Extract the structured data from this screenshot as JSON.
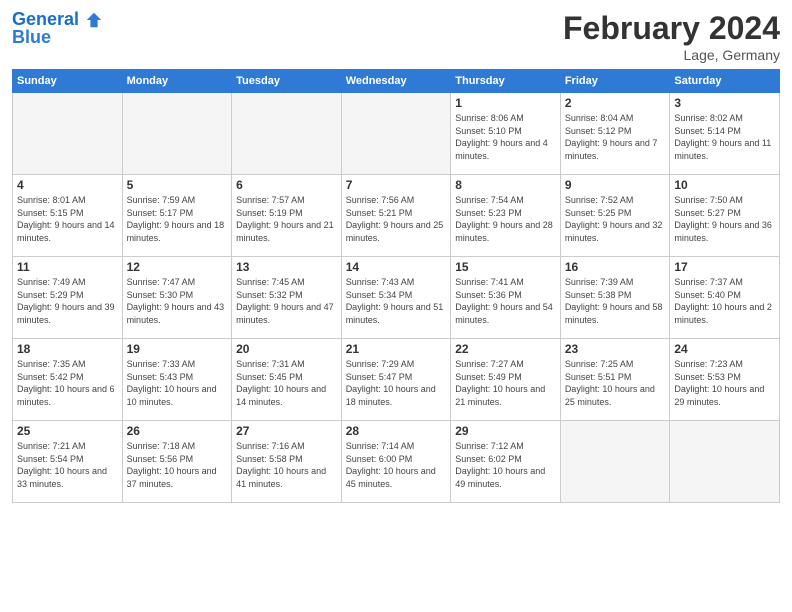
{
  "header": {
    "logo_line1": "General",
    "logo_line2": "Blue",
    "month_year": "February 2024",
    "location": "Lage, Germany"
  },
  "weekdays": [
    "Sunday",
    "Monday",
    "Tuesday",
    "Wednesday",
    "Thursday",
    "Friday",
    "Saturday"
  ],
  "weeks": [
    [
      {
        "day": "",
        "info": ""
      },
      {
        "day": "",
        "info": ""
      },
      {
        "day": "",
        "info": ""
      },
      {
        "day": "",
        "info": ""
      },
      {
        "day": "1",
        "info": "Sunrise: 8:06 AM\nSunset: 5:10 PM\nDaylight: 9 hours\nand 4 minutes."
      },
      {
        "day": "2",
        "info": "Sunrise: 8:04 AM\nSunset: 5:12 PM\nDaylight: 9 hours\nand 7 minutes."
      },
      {
        "day": "3",
        "info": "Sunrise: 8:02 AM\nSunset: 5:14 PM\nDaylight: 9 hours\nand 11 minutes."
      }
    ],
    [
      {
        "day": "4",
        "info": "Sunrise: 8:01 AM\nSunset: 5:15 PM\nDaylight: 9 hours\nand 14 minutes."
      },
      {
        "day": "5",
        "info": "Sunrise: 7:59 AM\nSunset: 5:17 PM\nDaylight: 9 hours\nand 18 minutes."
      },
      {
        "day": "6",
        "info": "Sunrise: 7:57 AM\nSunset: 5:19 PM\nDaylight: 9 hours\nand 21 minutes."
      },
      {
        "day": "7",
        "info": "Sunrise: 7:56 AM\nSunset: 5:21 PM\nDaylight: 9 hours\nand 25 minutes."
      },
      {
        "day": "8",
        "info": "Sunrise: 7:54 AM\nSunset: 5:23 PM\nDaylight: 9 hours\nand 28 minutes."
      },
      {
        "day": "9",
        "info": "Sunrise: 7:52 AM\nSunset: 5:25 PM\nDaylight: 9 hours\nand 32 minutes."
      },
      {
        "day": "10",
        "info": "Sunrise: 7:50 AM\nSunset: 5:27 PM\nDaylight: 9 hours\nand 36 minutes."
      }
    ],
    [
      {
        "day": "11",
        "info": "Sunrise: 7:49 AM\nSunset: 5:29 PM\nDaylight: 9 hours\nand 39 minutes."
      },
      {
        "day": "12",
        "info": "Sunrise: 7:47 AM\nSunset: 5:30 PM\nDaylight: 9 hours\nand 43 minutes."
      },
      {
        "day": "13",
        "info": "Sunrise: 7:45 AM\nSunset: 5:32 PM\nDaylight: 9 hours\nand 47 minutes."
      },
      {
        "day": "14",
        "info": "Sunrise: 7:43 AM\nSunset: 5:34 PM\nDaylight: 9 hours\nand 51 minutes."
      },
      {
        "day": "15",
        "info": "Sunrise: 7:41 AM\nSunset: 5:36 PM\nDaylight: 9 hours\nand 54 minutes."
      },
      {
        "day": "16",
        "info": "Sunrise: 7:39 AM\nSunset: 5:38 PM\nDaylight: 9 hours\nand 58 minutes."
      },
      {
        "day": "17",
        "info": "Sunrise: 7:37 AM\nSunset: 5:40 PM\nDaylight: 10 hours\nand 2 minutes."
      }
    ],
    [
      {
        "day": "18",
        "info": "Sunrise: 7:35 AM\nSunset: 5:42 PM\nDaylight: 10 hours\nand 6 minutes."
      },
      {
        "day": "19",
        "info": "Sunrise: 7:33 AM\nSunset: 5:43 PM\nDaylight: 10 hours\nand 10 minutes."
      },
      {
        "day": "20",
        "info": "Sunrise: 7:31 AM\nSunset: 5:45 PM\nDaylight: 10 hours\nand 14 minutes."
      },
      {
        "day": "21",
        "info": "Sunrise: 7:29 AM\nSunset: 5:47 PM\nDaylight: 10 hours\nand 18 minutes."
      },
      {
        "day": "22",
        "info": "Sunrise: 7:27 AM\nSunset: 5:49 PM\nDaylight: 10 hours\nand 21 minutes."
      },
      {
        "day": "23",
        "info": "Sunrise: 7:25 AM\nSunset: 5:51 PM\nDaylight: 10 hours\nand 25 minutes."
      },
      {
        "day": "24",
        "info": "Sunrise: 7:23 AM\nSunset: 5:53 PM\nDaylight: 10 hours\nand 29 minutes."
      }
    ],
    [
      {
        "day": "25",
        "info": "Sunrise: 7:21 AM\nSunset: 5:54 PM\nDaylight: 10 hours\nand 33 minutes."
      },
      {
        "day": "26",
        "info": "Sunrise: 7:18 AM\nSunset: 5:56 PM\nDaylight: 10 hours\nand 37 minutes."
      },
      {
        "day": "27",
        "info": "Sunrise: 7:16 AM\nSunset: 5:58 PM\nDaylight: 10 hours\nand 41 minutes."
      },
      {
        "day": "28",
        "info": "Sunrise: 7:14 AM\nSunset: 6:00 PM\nDaylight: 10 hours\nand 45 minutes."
      },
      {
        "day": "29",
        "info": "Sunrise: 7:12 AM\nSunset: 6:02 PM\nDaylight: 10 hours\nand 49 minutes."
      },
      {
        "day": "",
        "info": ""
      },
      {
        "day": "",
        "info": ""
      }
    ]
  ]
}
